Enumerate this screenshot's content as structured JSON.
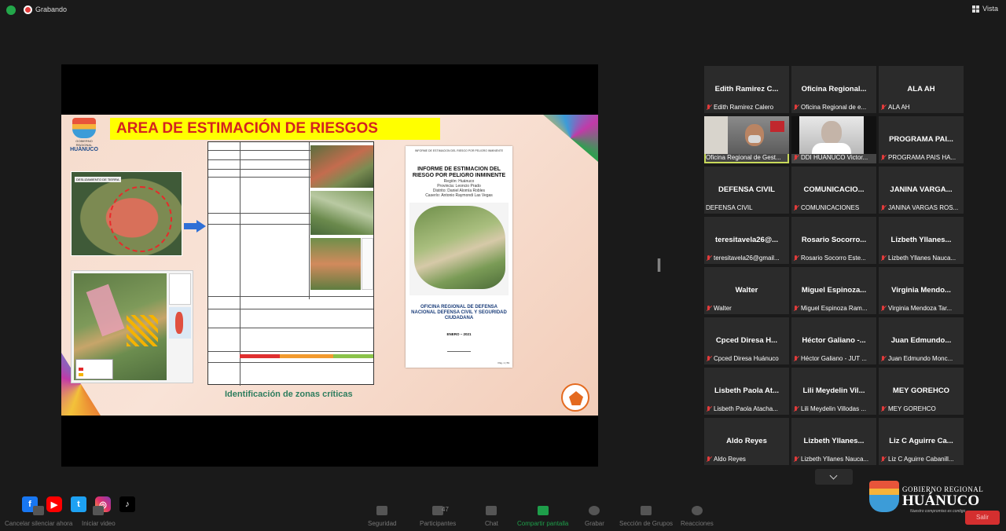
{
  "topbar": {
    "recording_label": "Grabando",
    "view_label": "Vista"
  },
  "slide": {
    "title": "AREA DE ESTIMACIÓN DE  RIESGOS",
    "logo_text_small": "GOBIERNO REGIONAL",
    "logo_text_big": "HUÁNUCO",
    "caption": "Identificación de zonas críticas",
    "photo_label": "DESLIZAMIENTO DE TIERRA",
    "report": {
      "header": "INFORME DE ESTIMACION DEL RIESGO POR PELIGRO INMINENTE",
      "title": "INFORME DE ESTIMACION DEL RIESGO POR PELIGRO INMINENTE",
      "region": "Región: Huánuco",
      "provincia": "Provincia: Leoncio Prado",
      "distrito": "Distrito: Daniel Alomía Robles",
      "caserio": "Caserío: Antonio Raymondi Las Vegas",
      "org": "OFICINA REGIONAL DE DEFENSA NACIONAL DEFENSA CIVIL Y SEGURIDAD CIUDADANA",
      "date": "ENERO – 2021",
      "page": "Pág. 1 | 59"
    }
  },
  "participants": [
    {
      "big": "Edith Ramirez C...",
      "name": "Edith Ramirez Calero",
      "muted": true,
      "video": false
    },
    {
      "big": "Oficina Regional...",
      "name": "Oficina Regional de e...",
      "muted": true,
      "video": false
    },
    {
      "big": "ALA AH",
      "name": "ALA AH",
      "muted": true,
      "video": false
    },
    {
      "big": "",
      "name": "Oficina Regional de Gest...",
      "muted": false,
      "video": true,
      "active": true
    },
    {
      "big": "",
      "name": "DDI HUANUCO Victor...",
      "muted": true,
      "video": true
    },
    {
      "big": "PROGRAMA PAI...",
      "name": "PROGRAMA PAIS HA...",
      "muted": true,
      "video": false
    },
    {
      "big": "DEFENSA CIVIL",
      "name": "DEFENSA CIVIL",
      "muted": false,
      "video": false
    },
    {
      "big": "COMUNICACIO...",
      "name": "COMUNICACIONES",
      "muted": true,
      "video": false
    },
    {
      "big": "JANINA VARGA...",
      "name": "JANINA VARGAS ROS...",
      "muted": true,
      "video": false
    },
    {
      "big": "teresitavela26@...",
      "name": "teresitavela26@gmail...",
      "muted": true,
      "video": false
    },
    {
      "big": "Rosario Socorro...",
      "name": "Rosario Socorro Este...",
      "muted": true,
      "video": false
    },
    {
      "big": "Lizbeth Yllanes...",
      "name": "Lizbeth Yllanes Nauca...",
      "muted": true,
      "video": false
    },
    {
      "big": "Walter",
      "name": "Walter",
      "muted": true,
      "video": false
    },
    {
      "big": "Miguel Espinoza...",
      "name": "Miguel Espinoza Ram...",
      "muted": true,
      "video": false
    },
    {
      "big": "Virginia Mendo...",
      "name": "Virginia Mendoza Tar...",
      "muted": true,
      "video": false
    },
    {
      "big": "Cpced Diresa H...",
      "name": "Cpced Diresa Huánuco",
      "muted": true,
      "video": false
    },
    {
      "big": "Héctor Galiano -...",
      "name": "Héctor Galiano - JUT ...",
      "muted": true,
      "video": false
    },
    {
      "big": "Juan Edmundo...",
      "name": "Juan Edmundo Monc...",
      "muted": true,
      "video": false
    },
    {
      "big": "Lisbeth Paola At...",
      "name": "Lisbeth Paola Atacha...",
      "muted": true,
      "video": false
    },
    {
      "big": "Lili Meydelin Vil...",
      "name": "Lili Meydelin Villodas ...",
      "muted": true,
      "video": false
    },
    {
      "big": "MEY GOREHCO",
      "name": "MEY GOREHCO",
      "muted": true,
      "video": false
    },
    {
      "big": "Aldo Reyes",
      "name": "Aldo Reyes",
      "muted": true,
      "video": false
    },
    {
      "big": "Lizbeth Yllanes...",
      "name": "Lizbeth Yllanes Nauca...",
      "muted": true,
      "video": false
    },
    {
      "big": "Liz C Aguirre Ca...",
      "name": "Liz C Aguirre Cabanill...",
      "muted": true,
      "video": false
    }
  ],
  "brand": {
    "line1": "GOBIERNO REGIONAL",
    "line2": "HUÁNUCO",
    "tagline": "Nuestro compromiso es contigo"
  },
  "toolbar": {
    "mute": "Cancelar silenciar ahora",
    "video": "Iniciar video",
    "security": "Seguridad",
    "participants": "Participantes",
    "participants_count": "47",
    "chat": "Chat",
    "share": "Compartir pantalla",
    "record": "Grabar",
    "rooms": "Sección de Grupos",
    "reactions": "Reacciones",
    "exit": "Salir"
  },
  "social": [
    "f",
    "▶",
    "t",
    "◎",
    "♪"
  ]
}
